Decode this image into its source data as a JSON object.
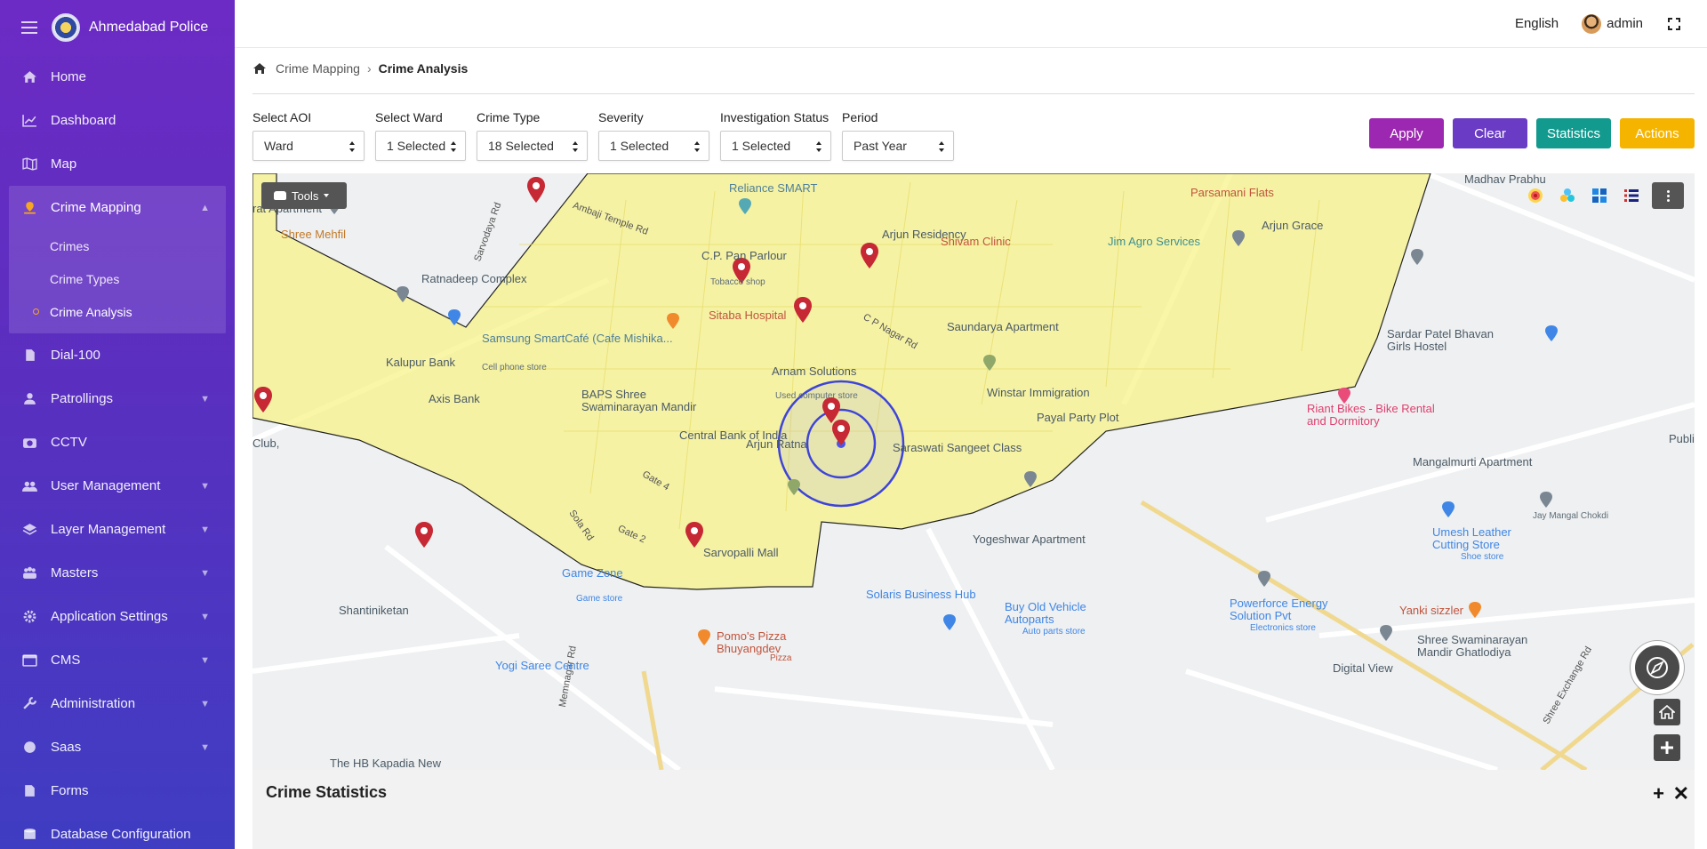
{
  "app": {
    "name": "Ahmedabad Police"
  },
  "sidebar": {
    "items": [
      {
        "label": "Home"
      },
      {
        "label": "Dashboard"
      },
      {
        "label": "Map"
      },
      {
        "label": "Crime Mapping",
        "sub": [
          "Crimes",
          "Crime Types",
          "Crime Analysis"
        ]
      },
      {
        "label": "Dial-100"
      },
      {
        "label": "Patrollings"
      },
      {
        "label": "CCTV"
      },
      {
        "label": "User Management"
      },
      {
        "label": "Layer Management"
      },
      {
        "label": "Masters"
      },
      {
        "label": "Application Settings"
      },
      {
        "label": "CMS"
      },
      {
        "label": "Administration"
      },
      {
        "label": "Saas"
      },
      {
        "label": "Forms"
      },
      {
        "label": "Database Configuration"
      }
    ]
  },
  "header": {
    "language": "English",
    "user": "admin"
  },
  "breadcrumb": {
    "parent": "Crime Mapping",
    "current": "Crime Analysis"
  },
  "filters": [
    {
      "label": "Select AOI",
      "value": "Ward"
    },
    {
      "label": "Select Ward",
      "value": "1 Selected"
    },
    {
      "label": "Crime Type",
      "value": "18 Selected"
    },
    {
      "label": "Severity",
      "value": "1 Selected"
    },
    {
      "label": "Investigation Status",
      "value": "1 Selected"
    },
    {
      "label": "Period",
      "value": "Past Year"
    }
  ],
  "buttons": {
    "apply": "Apply",
    "clear": "Clear",
    "statistics": "Statistics",
    "actions": "Actions"
  },
  "colors": {
    "apply": "#9c27b0",
    "clear": "#6a3bc4",
    "statistics": "#139a8e",
    "actions": "#f5b400",
    "ward_fill": "#f7f38a",
    "crime_marker": "#c62834"
  },
  "map": {
    "tools_label": "Tools",
    "places": [
      "Reliance SMART",
      "Parsamani Flats",
      "rat Apartment",
      "Arjun Residency",
      "Shivam Clinic",
      "Jim Agro Services",
      "Arjun Grace",
      "Shree Mehfil",
      "Ambaji Temple Rd",
      "Sarvodaya Rd",
      "Ratnadeep Complex",
      "C.P. Pan Parlour",
      "Tobacco shop",
      "Sitaba Hospital",
      "C P Nagar Rd",
      "Saundarya Apartment",
      "Sardar Patel Bhavan Girls Hostel",
      "Samsung SmartCafé (Cafe Mishika...",
      "Cell phone store",
      "Kalupur Bank",
      "Arnam Solutions",
      "Used computer store",
      "Axis Bank",
      "BAPS Shree Swaminarayan Mandir",
      "Winstar Immigration",
      "Payal Party Plot",
      "Riant Bikes - Bike Rental and Dormitory",
      "Central Bank of India",
      "Arjun Ratna",
      "Saraswati Sangeet Class",
      "Club,",
      "Mangalmurti Apartment",
      "Jay Mangal Chokdi",
      "Gate 4",
      "Sola Rd",
      "Gate 2",
      "Sarvopalli Mall",
      "Yogeshwar Apartment",
      "Umesh Leather Cutting Store",
      "Shoe store",
      "Game Zone",
      "Game store",
      "Solaris Business Hub",
      "Buy Old Vehicle Autoparts",
      "Auto parts store",
      "Powerforce Energy Solution Pvt",
      "Electronics store",
      "Yanki sizzler",
      "Shantiniketan",
      "Pomo's Pizza Bhuyangdev",
      "Pizza",
      "Memnagar Rd",
      "Shree Swaminarayan Mandir Ghatlodiya",
      "Digital View",
      "Yogi Saree Centre",
      "The HB Kapadia New",
      "Shree Exchange Rd",
      "Madhav Prabhu",
      "Public T"
    ]
  },
  "stats_panel": {
    "title": "Crime Statistics"
  }
}
